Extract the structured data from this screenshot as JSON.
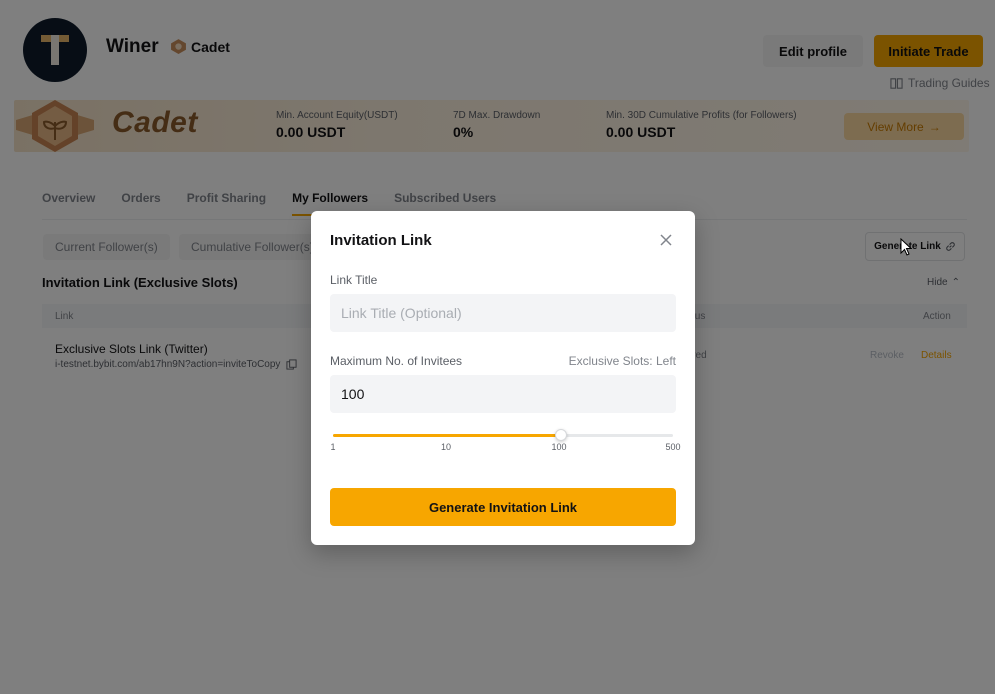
{
  "profile": {
    "name": "Winer",
    "level": "Cadet",
    "edit_label": "Edit profile",
    "trade_label": "Initiate Trade",
    "guides_label": "Trading Guides"
  },
  "banner": {
    "level": "Cadet",
    "stats": [
      {
        "label": "Min. Account Equity(USDT)",
        "value": "0.00 USDT"
      },
      {
        "label": "7D Max. Drawdown",
        "value": "0%"
      },
      {
        "label": "Min. 30D Cumulative Profits (for Followers)",
        "value": "0.00 USDT"
      }
    ],
    "view_more": "View More"
  },
  "tabs": [
    "Overview",
    "Orders",
    "Profit Sharing",
    "My Followers",
    "Subscribed Users"
  ],
  "active_tab": "My Followers",
  "filters": [
    "Current Follower(s)",
    "Cumulative Follower(s)"
  ],
  "generate_link_label": "Generate Link",
  "section": {
    "title": "Invitation Link (Exclusive Slots)",
    "hide_label": "Hide"
  },
  "table": {
    "headers": {
      "link": "Link",
      "status": "tus",
      "action": "Action"
    },
    "row": {
      "title": "Exclusive Slots Link (Twitter)",
      "url": "i-testnet.bybit.com/ab17hn9N?action=inviteToCopy",
      "status": "ired",
      "revoke": "Revoke",
      "details": "Details"
    }
  },
  "modal": {
    "title": "Invitation Link",
    "link_title_label": "Link Title",
    "link_title_placeholder": "Link Title (Optional)",
    "link_title_value": "",
    "max_invitees_label": "Maximum No. of Invitees",
    "exclusive_slots_hint": "Exclusive Slots: Left",
    "max_invitees_value": "100",
    "slider": {
      "value": 100,
      "ticks": [
        "1",
        "10",
        "100",
        "500"
      ],
      "fill_fraction": 0.67
    },
    "submit_label": "Generate Invitation Link"
  },
  "colors": {
    "accent": "#f7a600",
    "overlay": "rgba(0,0,0,0.5)"
  }
}
